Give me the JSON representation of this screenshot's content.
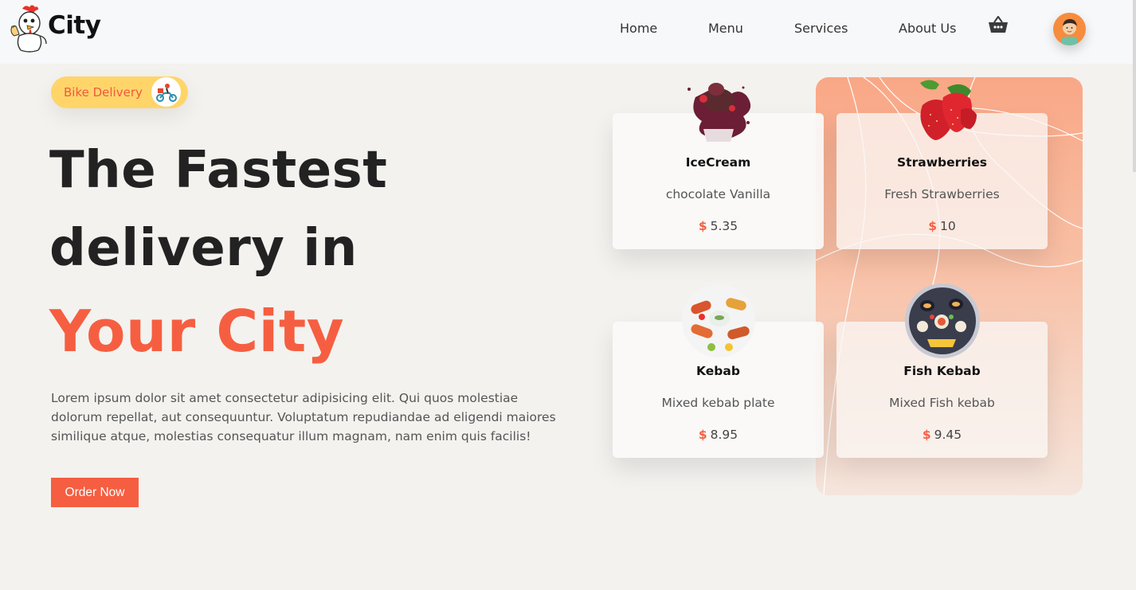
{
  "header": {
    "logo_text": "City",
    "nav": [
      "Home",
      "Menu",
      "Services",
      "About Us"
    ],
    "cart_icon": "basket-icon",
    "avatar_icon": "user-avatar-icon"
  },
  "hero": {
    "badge": "Bike Delivery",
    "headline_line1": "The Fastest",
    "headline_line2": "delivery in",
    "headline_line3": "Your City",
    "description": "Lorem ipsum dolor sit amet consectetur adipisicing elit. Qui quos molestiae dolorum repellat, aut consequuntur. Voluptatum repudiandae ad eligendi maiores similique atque, molestias consequatur illum magnam, nam enim quis facilis!",
    "cta": "Order Now"
  },
  "items": [
    {
      "title": "IceCream",
      "subtitle": "chocolate Vanilla",
      "currency": "$",
      "price": "5.35"
    },
    {
      "title": "Strawberries",
      "subtitle": "Fresh Strawberries",
      "currency": "$",
      "price": "10"
    },
    {
      "title": "Kebab",
      "subtitle": "Mixed kebab plate",
      "currency": "$",
      "price": "8.95"
    },
    {
      "title": "Fish Kebab",
      "subtitle": "Mixed Fish kebab",
      "currency": "$",
      "price": "9.45"
    }
  ],
  "colors": {
    "accent": "#f65e41",
    "badge_bg": "#ffd56a",
    "panel_top": "#f9a786",
    "background": "#f3f2ef"
  }
}
